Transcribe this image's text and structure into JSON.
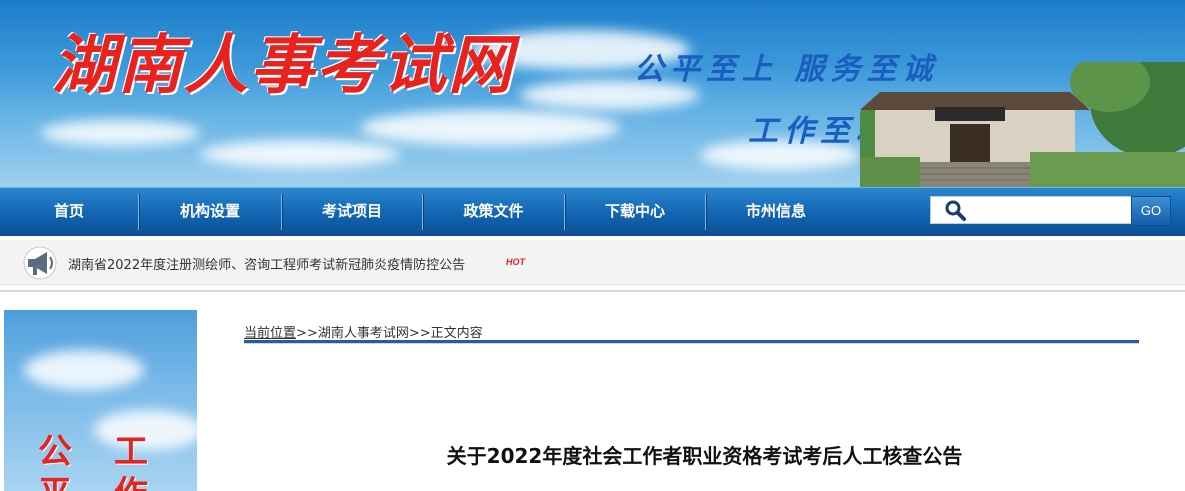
{
  "header": {
    "site_title": "湖南人事考试网",
    "slogan_line1": "公平至上  服务至诚",
    "slogan_line2": "工作至精  管理至严"
  },
  "nav": {
    "items": [
      {
        "label": "首页"
      },
      {
        "label": "机构设置"
      },
      {
        "label": "考试项目"
      },
      {
        "label": "政策文件"
      },
      {
        "label": "下载中心"
      },
      {
        "label": "市州信息"
      }
    ],
    "search": {
      "value": "",
      "placeholder": ""
    },
    "go_label": "GO"
  },
  "notice": {
    "text": "湖南省2022年度注册测绘师、咨询工程师考试新冠肺炎疫情防控公告",
    "badge": "HOT"
  },
  "sidebar_banner": {
    "chars": [
      "公",
      "工",
      "平",
      "作"
    ]
  },
  "breadcrumb": {
    "current_label": "当前位置",
    "sep1": ">>",
    "site": "湖南人事考试网",
    "sep2": ">>",
    "page": "正文内容"
  },
  "article": {
    "title": "关于2022年度社会工作者职业资格考试考后人工核查公告"
  },
  "colors": {
    "nav_bg": "#1264b0",
    "title_red": "#e8231f",
    "slogan_blue": "#1a5fc0",
    "breadcrumb_line": "#2c5aa0"
  }
}
